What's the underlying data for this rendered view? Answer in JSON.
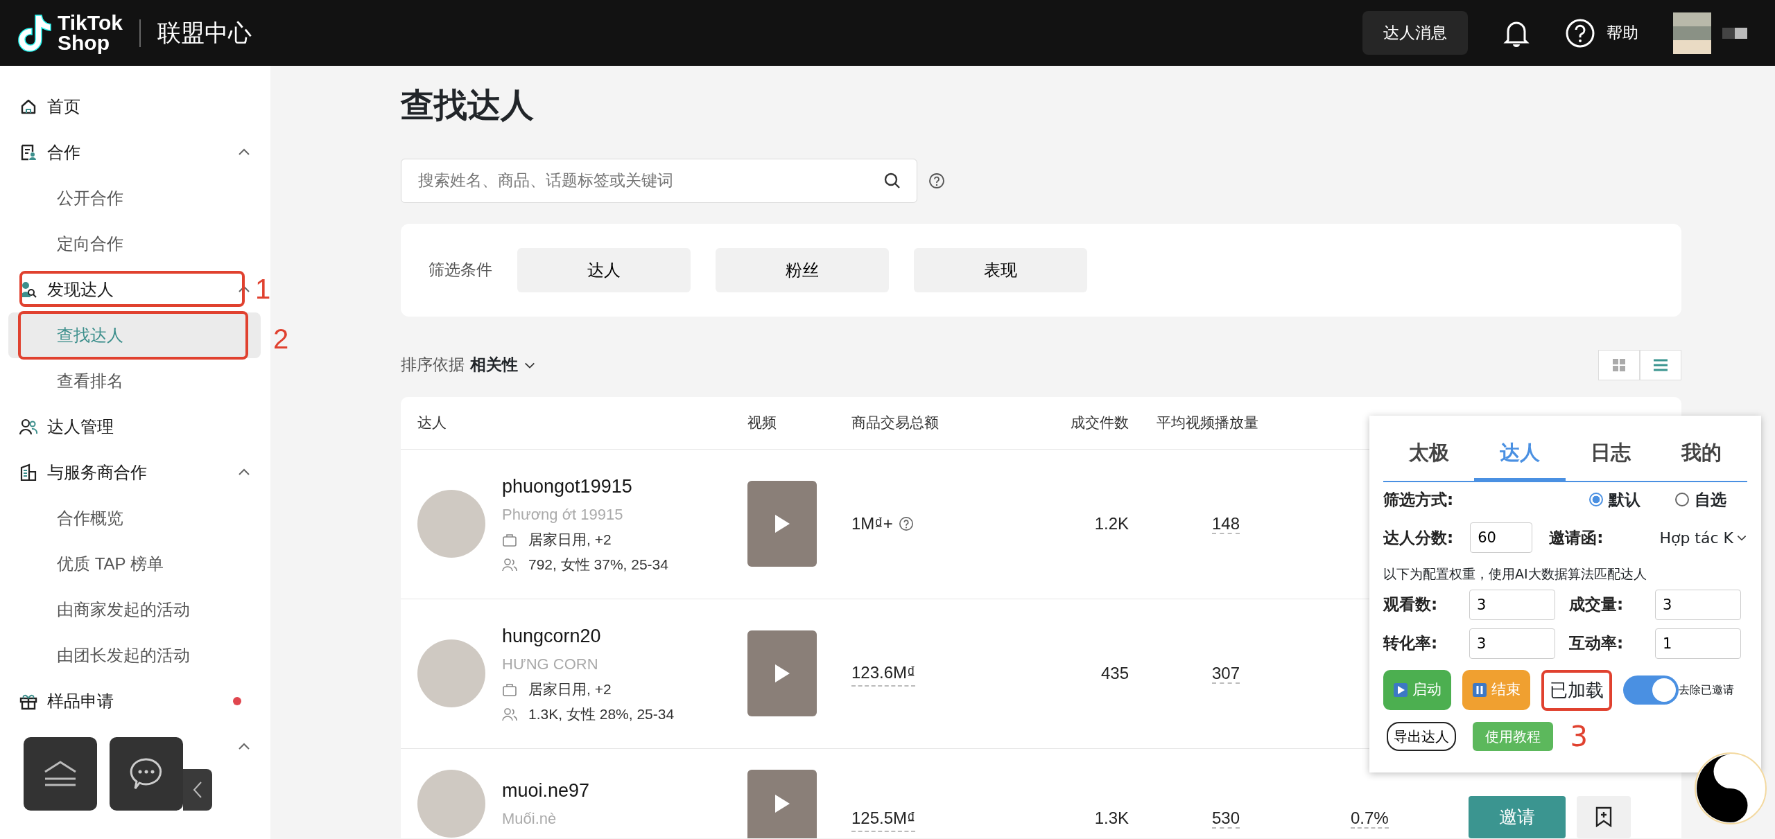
{
  "header": {
    "logo_words": [
      "TikTok",
      "Shop"
    ],
    "title": "联盟中心",
    "messages_button": "达人消息",
    "help": "帮助"
  },
  "sidebar": {
    "items": [
      {
        "kind": "link",
        "label": "首页",
        "selected": false,
        "notification": false
      },
      {
        "kind": "group",
        "label": "合作",
        "selected": false,
        "notification": false,
        "expanded": true,
        "children": [
          {
            "label": "公开合作",
            "selected": false
          },
          {
            "label": "定向合作",
            "selected": false
          }
        ]
      },
      {
        "kind": "group",
        "label": "发现达人",
        "selected": false,
        "notification": false,
        "expanded": true,
        "annotation": "1",
        "children": [
          {
            "label": "查找达人",
            "selected": true,
            "annotation": "2"
          },
          {
            "label": "查看排名",
            "selected": false
          }
        ]
      },
      {
        "kind": "link",
        "label": "达人管理",
        "selected": false,
        "notification": false
      },
      {
        "kind": "group",
        "label": "与服务商合作",
        "selected": false,
        "notification": false,
        "expanded": true,
        "children": [
          {
            "label": "合作概览",
            "selected": false
          },
          {
            "label": "优质 TAP 榜单",
            "selected": false
          },
          {
            "label": "由商家发起的活动",
            "selected": false
          },
          {
            "label": "由团长发起的活动",
            "selected": false
          }
        ]
      },
      {
        "kind": "link",
        "label": "样品申请",
        "selected": false,
        "notification": true
      },
      {
        "kind": "group",
        "selected": false,
        "notification": false,
        "expanded": true
      }
    ]
  },
  "main": {
    "title": "查找达人",
    "search": {
      "placeholder": "搜索姓名、商品、话题标签或关键词"
    },
    "filters": {
      "label": "筛选条件",
      "buttons": [
        "达人",
        "粉丝",
        "表现"
      ]
    },
    "sort": {
      "label": "排序依据",
      "value": "相关性"
    },
    "view_toggle": [
      {
        "kind": "grid",
        "selected": false
      },
      {
        "kind": "list",
        "selected": true
      }
    ],
    "table": {
      "columns": [
        "达人",
        "视频",
        "商品交易总额",
        "成交件数",
        "平均视频播放量"
      ],
      "rows": [
        {
          "handle": "phuongot19915",
          "name": "Phương ớt 19915",
          "category": "居家日用, +2",
          "audience": "792, 女性 37%, 25-34",
          "gmv": "1M₫+",
          "gmv_info": true,
          "items_sold": "1.2K",
          "avg_views": "148"
        },
        {
          "handle": "hungcorn20",
          "name": "HƯNG CORN",
          "category": "居家日用, +2",
          "audience": "1.3K, 女性 28%, 25-34",
          "gmv": "123.6M₫",
          "gmv_info": false,
          "items_sold": "435",
          "avg_views": "307"
        },
        {
          "handle": "muoi.ne97",
          "name": "Muối.nè",
          "gmv": "125.5M₫",
          "gmv_info": false,
          "items_sold": "1.3K",
          "avg_views": "530",
          "column_6": "0.7%",
          "invite_button": "邀请"
        }
      ]
    }
  },
  "panel": {
    "tabs": [
      {
        "label": "太极",
        "selected": false
      },
      {
        "label": "达人",
        "selected": true
      },
      {
        "label": "日志",
        "selected": false
      },
      {
        "label": "我的",
        "selected": false
      }
    ],
    "filter_mode": {
      "label": "筛选方式:",
      "options": [
        {
          "label": "默认",
          "selected": true
        },
        {
          "label": "自选",
          "selected": false
        }
      ]
    },
    "score": {
      "label": "达人分数:",
      "value": "60"
    },
    "invite": {
      "label": "邀请函:",
      "value": "Hợp tác K"
    },
    "description": "以下为配置权重，使用AI大数据算法匹配达人",
    "weights": [
      {
        "label": "观看数:",
        "value": "3"
      },
      {
        "label": "成交量:",
        "value": "3"
      },
      {
        "label": "转化率:",
        "value": "3"
      },
      {
        "label": "互动率:",
        "value": "1"
      }
    ],
    "start_button": "启动",
    "stop_button": "结束",
    "status": "已加载",
    "status_annotation": "3",
    "toggle": {
      "label": "去除已邀请",
      "on": true
    },
    "export_button": "导出达人",
    "tutorial_button": "使用教程"
  }
}
